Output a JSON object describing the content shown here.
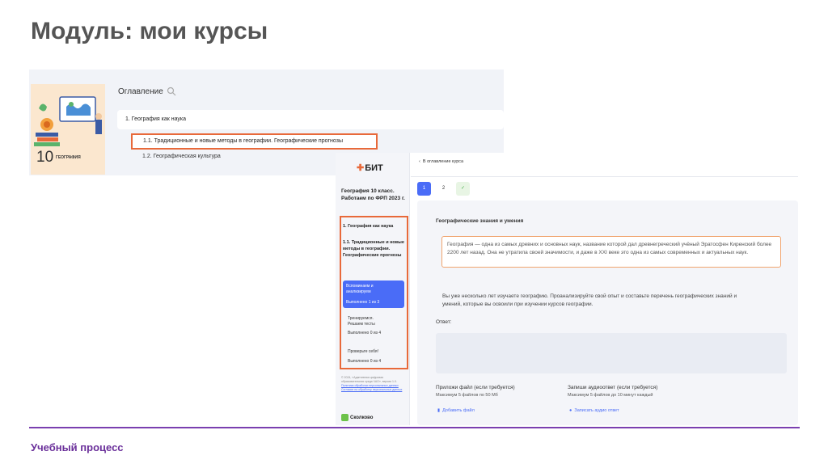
{
  "slide": {
    "title": "Модуль: мои курсы",
    "footer": "Учебный процесс",
    "accent_color": "#7a3fb0",
    "highlight_color": "#e8693a"
  },
  "contents_view": {
    "cover_grade": "10",
    "cover_subject": "ГЕОГРАФИЯ",
    "toc_title": "Оглавление",
    "search_icon": "search-icon",
    "items": [
      "1. География как наука",
      "1.1. Традиционные и новые методы в географии. Географические прогнозы",
      "1.2. Географическая культура"
    ]
  },
  "lesson_view": {
    "logo_text": "БИТ",
    "course_title": "География 10 класс. Работаем по ФРП 2023 г.",
    "sidebar": {
      "section": "1. География как наука",
      "subsection": "1.1. Традиционные и новые методы в географии. Географические прогнозы",
      "steps": [
        {
          "label": "Вспоминаем и анализируем",
          "progress": "Выполнено 1 из 3"
        },
        {
          "label": "Тренируемся. Решаем тесты",
          "progress": "Выполнено 0 из 4"
        },
        {
          "label": "Проверьте себя!",
          "progress": "Выполнено 0 из 4"
        }
      ],
      "footer_lines": [
        "© 2024, «Адаптивная цифровая образовательная среда ЧАО», версия 1.0.",
        "Политика обработки персональных данных",
        "Согласие на обработку персональных данных"
      ],
      "partner": "Сколково"
    },
    "back_link": "В оглавление курса",
    "tabs": [
      "1",
      "2",
      "✓"
    ],
    "card_heading": "Географические знания и умения",
    "quote": "География — одна из самых древних и основных наук, название которой дал древнегреческий учёный Эратосфен Киренский более 2200 лет назад. Она не утратила своей значимости, и даже в XXI веке это одна из самых современных и актуальных наук.",
    "task": "Вы уже несколько лет изучаете географию. Проанализируйте свой опыт и составьте перечень географических знаний и умений, которые вы освоили при изучении курсов географии.",
    "answer_label": "Ответ:",
    "attach": {
      "title": "Приложи файл (если требуется)",
      "subtitle": "Максимум 5 файлов по 50 Мб",
      "button": "Добавить файл"
    },
    "audio": {
      "title": "Запиши аудиоответ (если требуется)",
      "subtitle": "Максимум 5 файлов до 10 минут каждый",
      "button": "Записать аудио ответ"
    }
  }
}
